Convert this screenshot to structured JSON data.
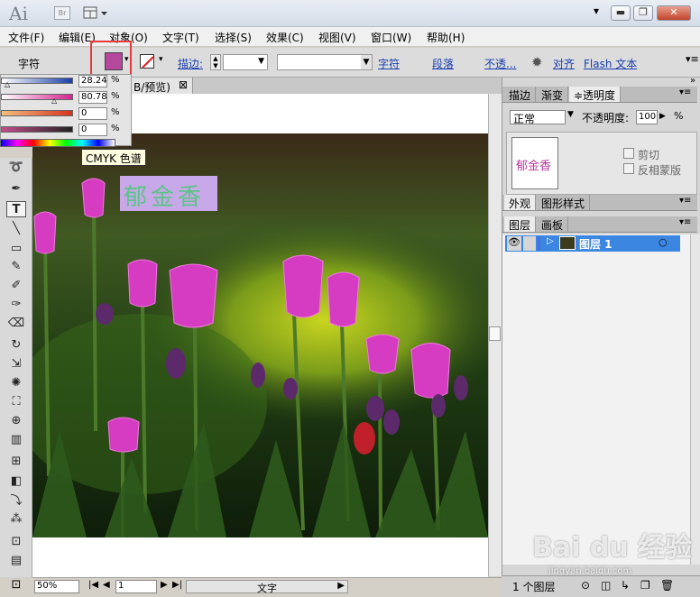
{
  "title_bar": {
    "app_logo": "Ai",
    "bridge_label": "Br",
    "buttons": {
      "minimize": "▬",
      "restore": "❐",
      "close": "✕"
    },
    "dropdown": "▾"
  },
  "menu": {
    "items": [
      "文件(F)",
      "编辑(E)",
      "对象(O)",
      "文字(T)",
      "选择(S)",
      "效果(C)",
      "视图(V)",
      "窗口(W)",
      "帮助(H)"
    ]
  },
  "control_bar": {
    "label": "字符",
    "fill_color": "#b5479c",
    "stroke_label": "描边:",
    "links": [
      "字符",
      "段落",
      "不透...",
      "对齐",
      "Flash 文本"
    ]
  },
  "color_panel": {
    "rows": [
      {
        "value": "28.24",
        "unit": "%",
        "color_start": "#ffffff",
        "color_end": "#1b3fa5"
      },
      {
        "value": "80.78",
        "unit": "%",
        "color_start": "#ffffff",
        "color_end": "#d3258f"
      },
      {
        "value": "0",
        "unit": "%",
        "color_start": "#ffffff",
        "color_end": "#d6341f"
      },
      {
        "value": "0",
        "unit": "%",
        "color_start": "#ffffff",
        "color_end": "#222222"
      }
    ],
    "tooltip": "CMYK 色谱"
  },
  "document": {
    "tab_label": "B/预览)",
    "tab_close": "⊠",
    "text_object": "郁金香",
    "text_color": "#5cc488",
    "text_bg": "#c8a8e8"
  },
  "status_bar": {
    "zoom": "50%",
    "page": "1",
    "tool_name": "文字"
  },
  "panels": {
    "top_tabs": [
      "描边",
      "渐变",
      "≑透明度"
    ],
    "blend_mode": "正常",
    "opacity_label": "不透明度:",
    "opacity_value": "100",
    "opacity_unit": "%",
    "thumb_text": "郁金香",
    "clip_label": "剪切",
    "invert_label": "反相蒙版",
    "appearance_tabs": [
      "外观",
      "图形样式"
    ],
    "layer_tabs": [
      "图层",
      "画板"
    ],
    "layer_name": "图层 1",
    "layer_count": "1 个图层"
  },
  "watermark": {
    "brand": "Bai du 经验",
    "url": "jingyan.baidu.com"
  }
}
